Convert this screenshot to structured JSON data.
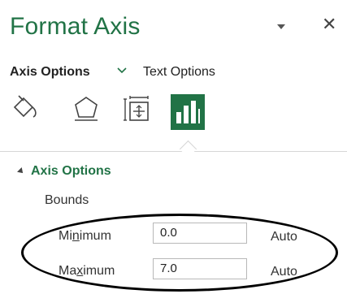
{
  "pane": {
    "title": "Format Axis",
    "menu_icon": "chevron-down-icon",
    "close_icon": "close-icon",
    "close_glyph": "✕"
  },
  "tabs": [
    {
      "label": "Axis Options",
      "selected": true,
      "chevron_icon": "chevron-down-icon"
    },
    {
      "label": "Text Options",
      "selected": false
    }
  ],
  "icons": [
    {
      "name": "fill-line-icon"
    },
    {
      "name": "effects-icon"
    },
    {
      "name": "size-properties-icon"
    },
    {
      "name": "axis-options-icon",
      "selected": true
    }
  ],
  "section": {
    "title": "Axis Options",
    "subheading": "Bounds",
    "rows": [
      {
        "label_pre": "Mi",
        "label_underlined": "n",
        "label_post": "imum",
        "value": "0.0",
        "auto_label": "Auto"
      },
      {
        "label_pre": "Ma",
        "label_underlined": "x",
        "label_post": "imum",
        "value": "7.0",
        "auto_label": "Auto"
      }
    ]
  },
  "colors": {
    "accent": "#217346",
    "highlight_ellipse": "#000000"
  }
}
